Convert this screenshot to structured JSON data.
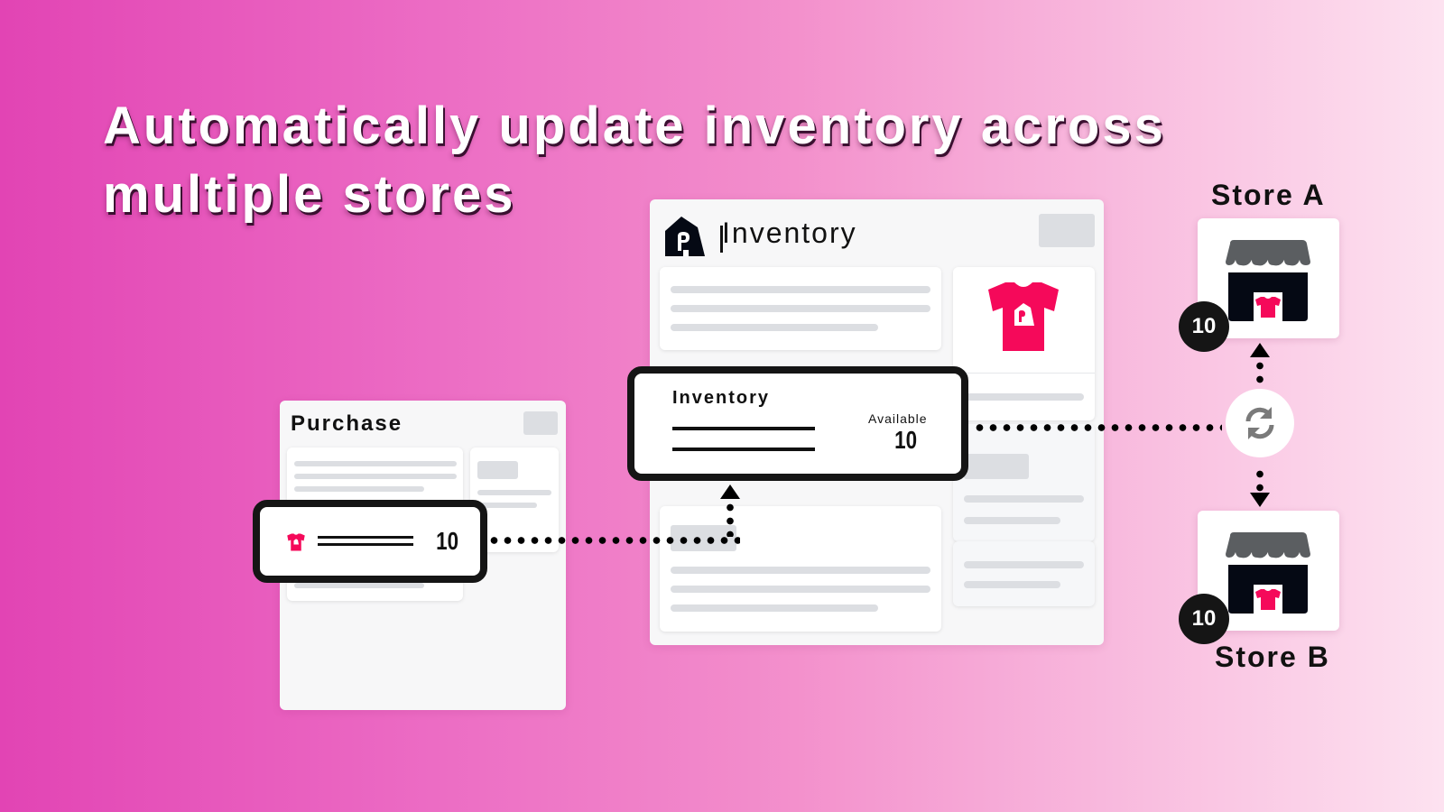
{
  "headline": {
    "line1": "Automatically update inventory across",
    "line2": "multiple stores"
  },
  "inventory_panel": {
    "title": "Inventory",
    "product_icon": "tshirt-icon"
  },
  "inventory_highlight": {
    "title": "Inventory",
    "available_label": "Available",
    "available_value": "10"
  },
  "purchase_panel": {
    "title": "Purchase"
  },
  "purchase_highlight": {
    "quantity": "10",
    "product_icon": "tshirt-icon"
  },
  "sync": {
    "icon": "sync-icon"
  },
  "stores": [
    {
      "label": "Store A",
      "count": "10",
      "icon": "storefront-icon"
    },
    {
      "label": "Store B",
      "count": "10",
      "icon": "storefront-icon"
    }
  ],
  "colors": {
    "brand_pink": "#f5095a",
    "awning_gray": "#5b5e61",
    "store_dark": "#050914",
    "background_start": "#e244b4",
    "background_end": "#fde2f0"
  }
}
